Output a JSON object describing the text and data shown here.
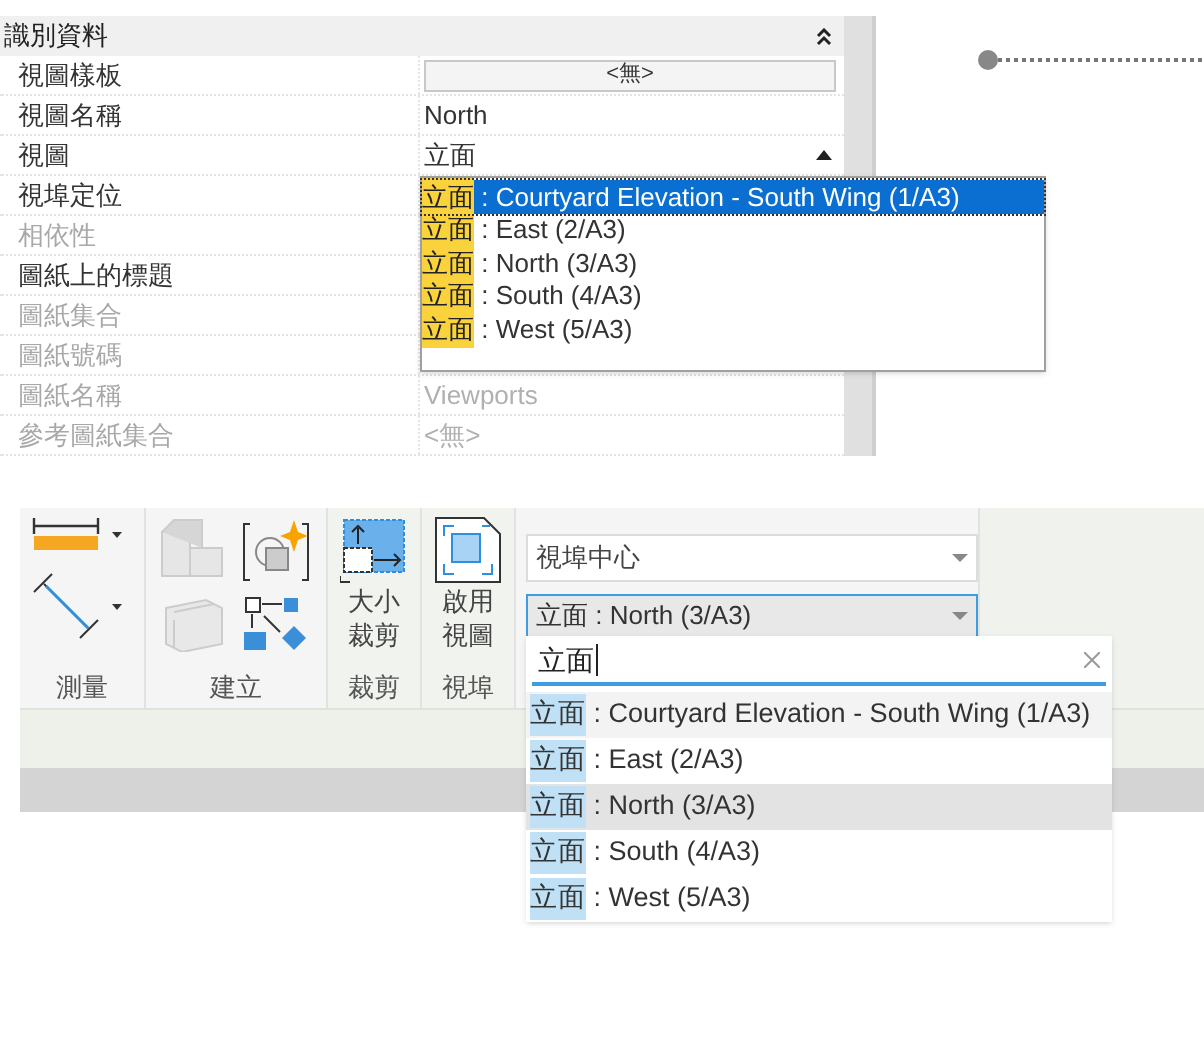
{
  "properties": {
    "section_title": "識別資料",
    "rows": [
      {
        "label": "視圖樣板",
        "value": "<無>",
        "kind": "button",
        "disabled": false
      },
      {
        "label": "視圖名稱",
        "value": "North",
        "kind": "text",
        "disabled": false
      },
      {
        "label": "視圖",
        "value": "立面",
        "kind": "combo",
        "disabled": false
      },
      {
        "label": "視埠定位",
        "kind": "text",
        "disabled": false
      },
      {
        "label": "相依性",
        "kind": "text",
        "disabled": true
      },
      {
        "label": "圖紙上的標題",
        "kind": "text",
        "disabled": false
      },
      {
        "label": "圖紙集合",
        "kind": "text",
        "disabled": true
      },
      {
        "label": "圖紙號碼",
        "kind": "text",
        "disabled": true
      },
      {
        "label": "圖紙名稱",
        "value": "Viewports",
        "kind": "text",
        "disabled": true
      },
      {
        "label": "參考圖紙集合",
        "value": "<無>",
        "kind": "text",
        "disabled": true
      }
    ],
    "dropdown": [
      {
        "match": "立面",
        "text": " : Courtyard Elevation - South Wing (1/A3)",
        "selected": true
      },
      {
        "match": "立面",
        "text": " : East (2/A3)",
        "selected": false
      },
      {
        "match": "立面",
        "text": " : North (3/A3)",
        "selected": false
      },
      {
        "match": "立面",
        "text": " : South (4/A3)",
        "selected": false
      },
      {
        "match": "立面",
        "text": " : West (5/A3)",
        "selected": false
      }
    ]
  },
  "ribbon": {
    "panels": [
      {
        "kind": "measure",
        "title": "測量"
      },
      {
        "kind": "create",
        "title": "建立"
      },
      {
        "kind": "crop",
        "title": "裁剪",
        "button": [
          "大小",
          "裁剪"
        ]
      },
      {
        "kind": "activate",
        "title": "視埠",
        "button": [
          "啟用",
          "視圖"
        ]
      }
    ],
    "position_combo": "視埠中心",
    "view_combo": "立面 : North (3/A3)",
    "search_value": "立面",
    "results": [
      {
        "match": "立面",
        "text": " : Courtyard Elevation - South Wing (1/A3)",
        "selected": false,
        "hovered": true
      },
      {
        "match": "立面",
        "text": " : East (2/A3)",
        "selected": false,
        "hovered": false
      },
      {
        "match": "立面",
        "text": " : North (3/A3)",
        "selected": true,
        "hovered": false
      },
      {
        "match": "立面",
        "text": " : South (4/A3)",
        "selected": false,
        "hovered": false
      },
      {
        "match": "立面",
        "text": " : West (5/A3)",
        "selected": false,
        "hovered": false
      }
    ]
  }
}
